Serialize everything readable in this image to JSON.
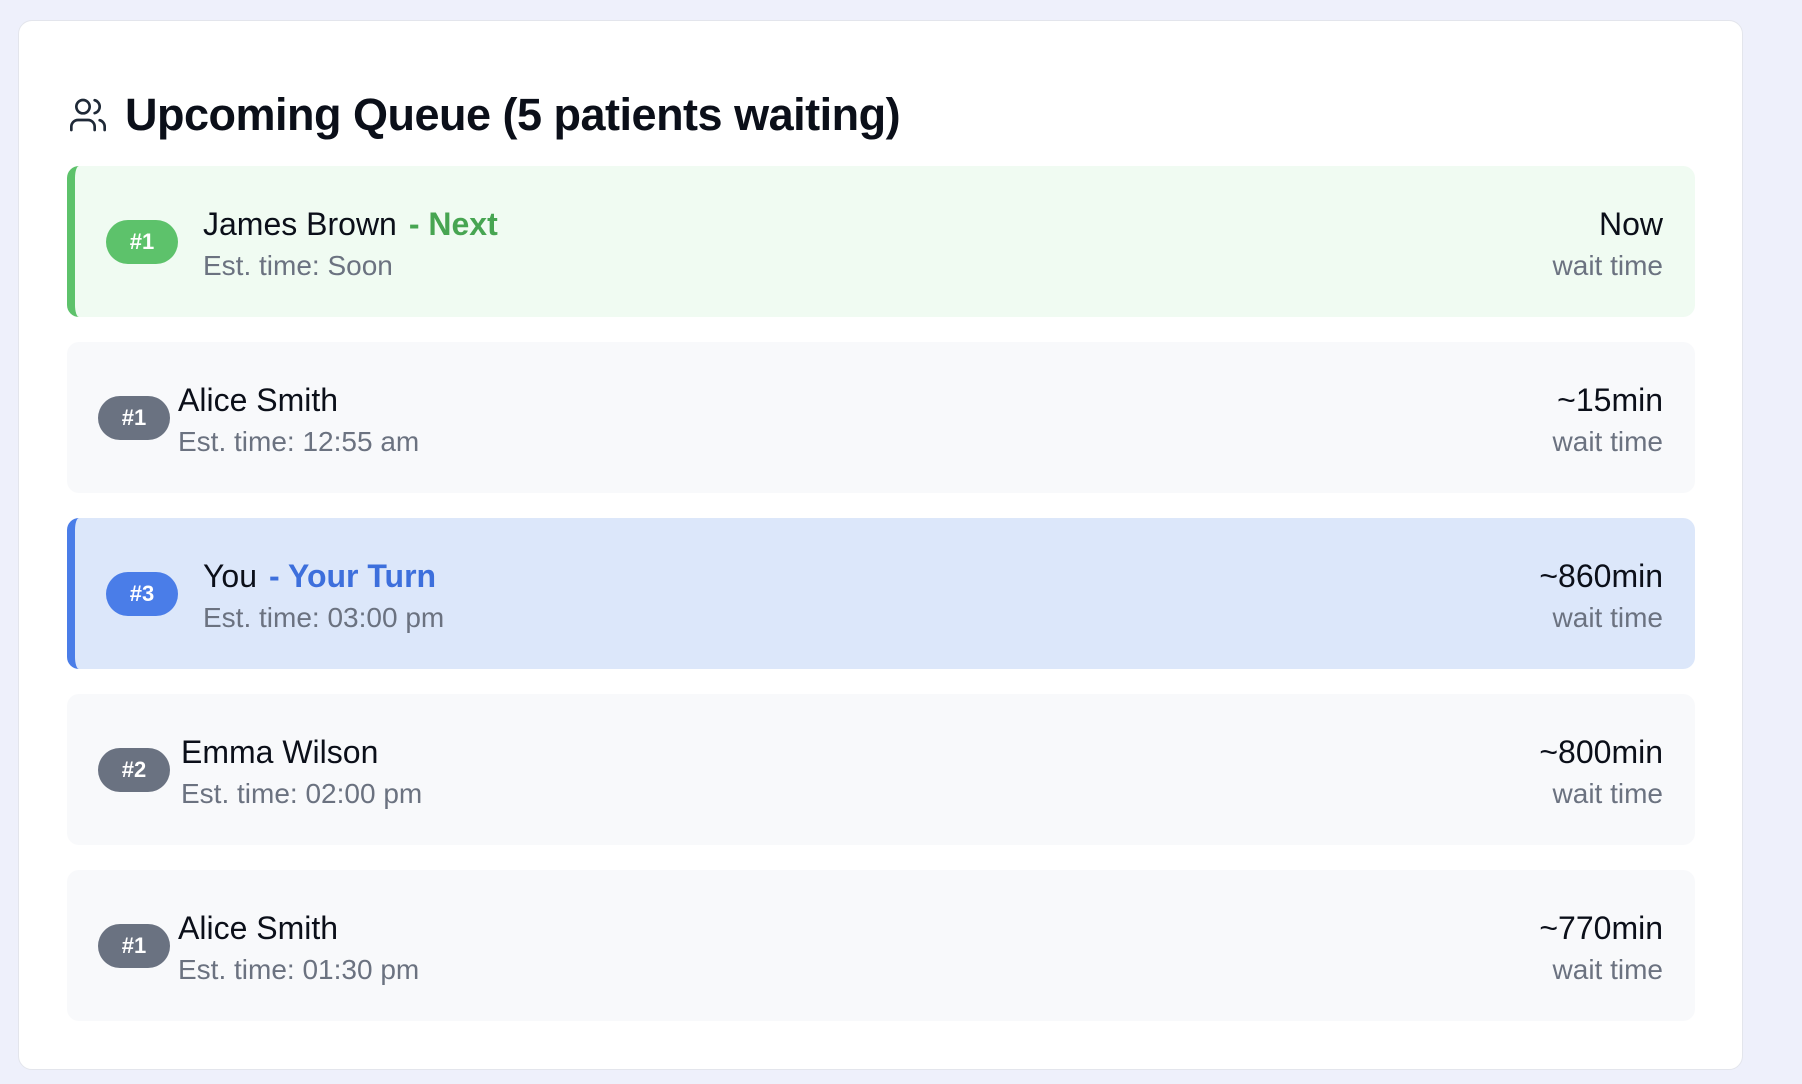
{
  "header": {
    "icon": "users-icon",
    "title": "Upcoming Queue (5 patients waiting)"
  },
  "queue": [
    {
      "badge": "#1",
      "name": "James Brown",
      "tag": "- Next",
      "est": "Est. time: Soon",
      "wait": "Now",
      "wait_label": "wait time",
      "status": "next"
    },
    {
      "badge": "#1",
      "name": "Alice Smith",
      "tag": "",
      "est": "Est. time: 12:55 am",
      "wait": "~15min",
      "wait_label": "wait time",
      "status": "waiting"
    },
    {
      "badge": "#3",
      "name": "You",
      "tag": "- Your Turn",
      "est": "Est. time: 03:00 pm",
      "wait": "~860min",
      "wait_label": "wait time",
      "status": "you"
    },
    {
      "badge": "#2",
      "name": "Emma Wilson",
      "tag": "",
      "est": "Est. time: 02:00 pm",
      "wait": "~800min",
      "wait_label": "wait time",
      "status": "waiting"
    },
    {
      "badge": "#1",
      "name": "Alice Smith",
      "tag": "",
      "est": "Est. time: 01:30 pm",
      "wait": "~770min",
      "wait_label": "wait time",
      "status": "waiting"
    }
  ],
  "colors": {
    "next_accent": "#5dc26b",
    "you_accent": "#4a7de8",
    "neutral_badge": "#6a7281"
  }
}
